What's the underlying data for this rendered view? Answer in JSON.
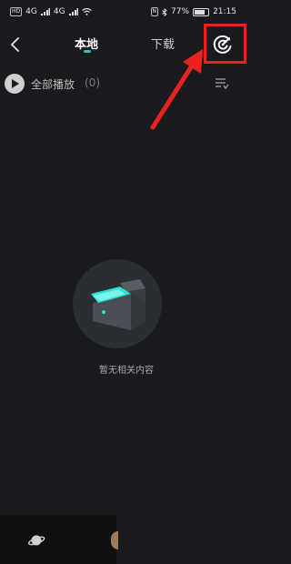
{
  "status": {
    "left_chip1": "HD",
    "left_chip2": "HD",
    "net1": "4G",
    "net2": "4G",
    "battery_percent": "77%",
    "battery_level": 0.77,
    "time": "21:15"
  },
  "header": {
    "tab_local": "本地",
    "tab_download": "下载"
  },
  "toolbar": {
    "play_all_label": "全部播放",
    "play_all_count": "(0)"
  },
  "empty": {
    "message": "暂无相关内容"
  },
  "colors": {
    "accent": "#27c5c2",
    "highlight": "#e8231f",
    "background": "#191a1d"
  }
}
